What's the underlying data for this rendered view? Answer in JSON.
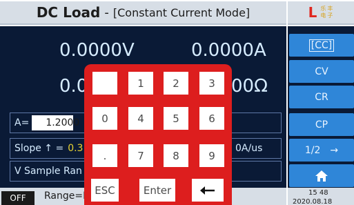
{
  "title": {
    "app_name": "DC Load",
    "separator": "-",
    "mode": "[Constant Current Mode]"
  },
  "logo": {
    "letter": "L",
    "chars": [
      "乐",
      "丰",
      "电",
      "子"
    ]
  },
  "readings": {
    "voltage": "0.0000V",
    "current": "0.0000A",
    "resistance_left": "0.0",
    "resistance_right": "00Ω"
  },
  "params": {
    "a_label": "A=",
    "a_value": "1.2000",
    "slope_label": "Slope ↑ =",
    "slope_value": "0.3",
    "slope_value_b": "0A/us",
    "v_sample_label": "V Sample Ran"
  },
  "status": {
    "off": "OFF",
    "range": "Range=M"
  },
  "sidebar": {
    "cc": "[CC]",
    "cv": "CV",
    "cr": "CR",
    "cp": "CP",
    "page": "1/2",
    "page_arrow": "→"
  },
  "clock": {
    "time": "15 48",
    "date": "2020.08.18"
  },
  "keypad": {
    "row1": [
      "",
      "1",
      "2",
      "3"
    ],
    "row2": [
      "0",
      "4",
      "5",
      "6"
    ],
    "row3": [
      ".",
      "7",
      "8",
      "9"
    ],
    "esc": "ESC",
    "enter": "Enter",
    "back_icon": "left-arrow"
  },
  "colors": {
    "keypad_bg": "#dd1e1e",
    "screen_bg": "#0a1a36",
    "sidebar_button": "#2f86d8",
    "reading_text": "#d6ecff",
    "slope_value": "#e8d232"
  }
}
